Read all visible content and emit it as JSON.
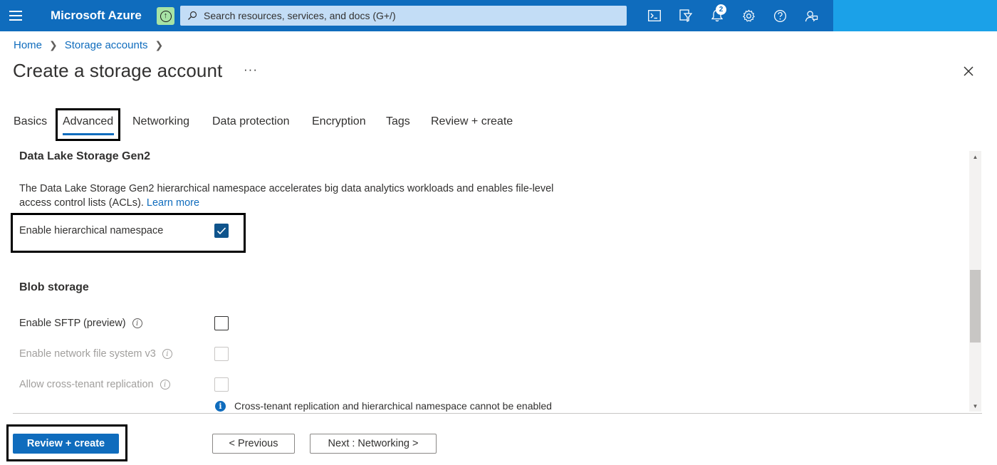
{
  "topbar": {
    "brand": "Microsoft Azure",
    "search_placeholder": "Search resources, services, and docs (G+/)",
    "notification_count": "2",
    "icons": [
      "cloud-shell-icon",
      "directory-filter-icon",
      "notifications-icon",
      "settings-icon",
      "help-icon",
      "feedback-icon"
    ]
  },
  "breadcrumb": {
    "home": "Home",
    "storage_accounts": "Storage accounts"
  },
  "page": {
    "title": "Create a storage account",
    "more": "···"
  },
  "tabs": {
    "basics": "Basics",
    "advanced": "Advanced",
    "networking": "Networking",
    "data_protection": "Data protection",
    "encryption": "Encryption",
    "tags": "Tags",
    "review_create": "Review + create",
    "active": "Advanced"
  },
  "data_lake": {
    "title": "Data Lake Storage Gen2",
    "description": "The Data Lake Storage Gen2 hierarchical namespace accelerates big data analytics workloads and enables file-level access control lists (ACLs).",
    "learn_more": "Learn more",
    "hns_label": "Enable hierarchical namespace",
    "hns_checked": true
  },
  "blob": {
    "title": "Blob storage",
    "sftp_label": "Enable SFTP (preview)",
    "sftp_checked": false,
    "nfs_label": "Enable network file system v3",
    "nfs_checked": false,
    "cross_tenant_label": "Allow cross-tenant replication",
    "cross_tenant_checked": false,
    "notice": "Cross-tenant replication and hierarchical namespace cannot be enabled"
  },
  "footer": {
    "review_create": "Review + create",
    "previous": "< Previous",
    "next": "Next : Networking >"
  },
  "colors": {
    "brand_blue": "#0f6cbd",
    "account_blue": "#1ba1e8",
    "checkbox_checked": "#0f548c"
  }
}
